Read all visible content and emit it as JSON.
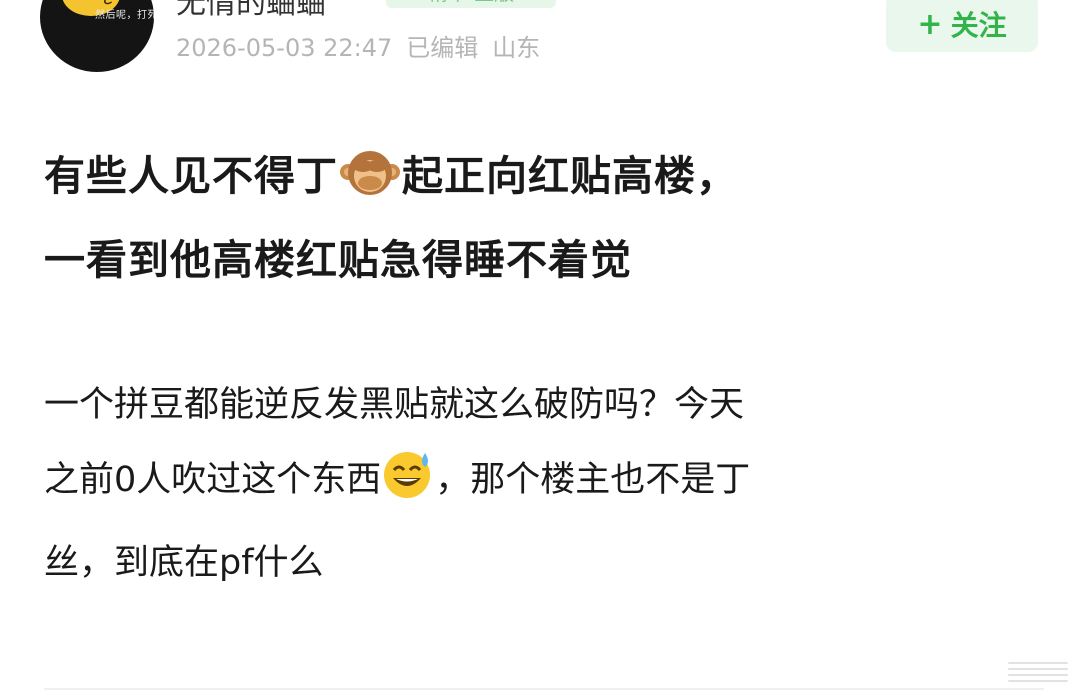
{
  "author": {
    "name": "无情的蛐蛐",
    "avatar_caption": "然后呢，打死我",
    "tag": "精华·正版",
    "timestamp": "2026-05-03 22:47",
    "edited": "已编辑",
    "location": "山东"
  },
  "follow": {
    "plus": "+",
    "label": "关注"
  },
  "post": {
    "title_line1_a": "有些人见不得丁",
    "title_line1_b": "起正向红贴高楼，",
    "title_line2": "一看到他高楼红贴急得睡不着觉",
    "body_line1": "一个拼豆都能逆反发黑贴就这么破防吗？今天",
    "body_line2_a": "之前0人吹过这个东西",
    "body_line2_b": "，那个楼主也不是丁",
    "body_line3": "丝，到底在pf什么"
  },
  "icons": {
    "title_emoji": "see-no-evil-monkey-icon",
    "body_emoji": "grinning-sweat-face-icon"
  }
}
